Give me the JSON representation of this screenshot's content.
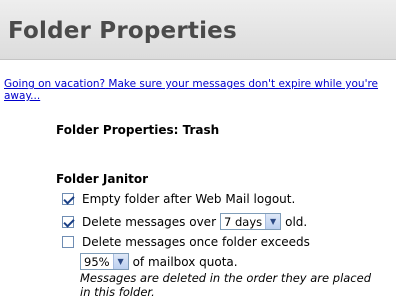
{
  "header": {
    "title": "Folder Properties"
  },
  "vacation_link": "Going on vacation? Make sure your messages don't expire while you're away...",
  "folder": {
    "subtitle": "Folder Properties: Trash"
  },
  "janitor": {
    "title": "Folder Janitor",
    "empty_after_logout": {
      "label": "Empty folder after Web Mail logout.",
      "checked": true
    },
    "delete_over": {
      "before": "Delete messages over",
      "select_value": "7 days",
      "after": "old.",
      "checked": true
    },
    "delete_exceeds": {
      "label": "Delete messages once folder exceeds",
      "select_value": "95%",
      "after": "of mailbox quota.",
      "checked": false
    },
    "note": "Messages are deleted in the order they are placed in this folder."
  },
  "colors": {
    "link": "#0000cc",
    "header_text": "#4a4a4a",
    "header_bg": "#e6e6e6"
  },
  "icons": {
    "dropdown": "chevron-down-icon",
    "checkbox": "checkbox-icon"
  }
}
